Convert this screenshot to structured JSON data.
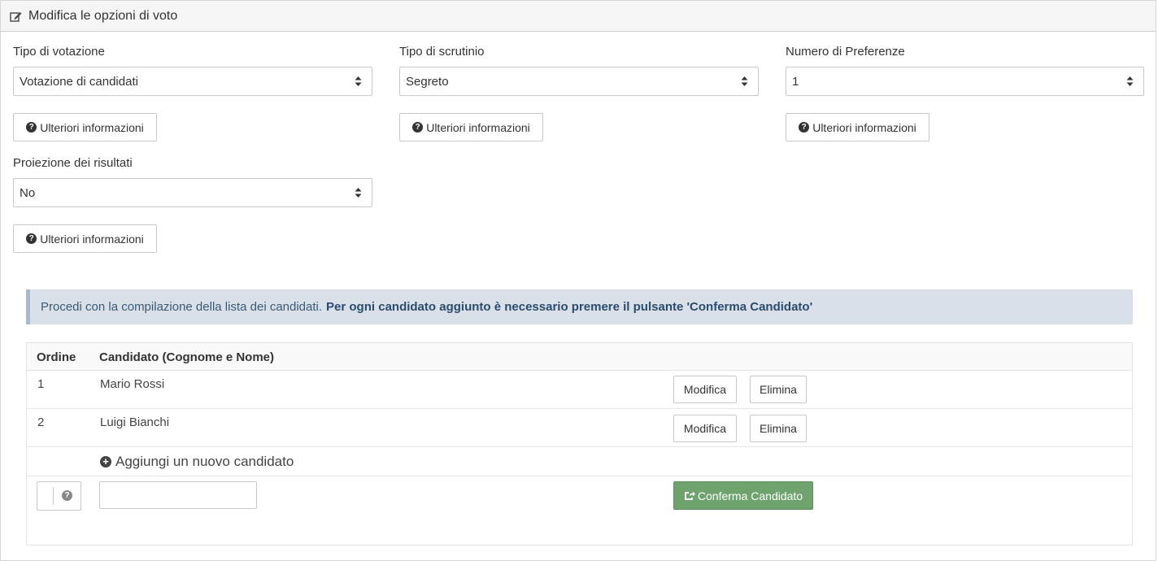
{
  "panel": {
    "title": "Modifica le opzioni di voto",
    "title_icon": "edit-icon"
  },
  "fields": {
    "tipo_votazione": {
      "label": "Tipo di votazione",
      "value": "Votazione di candidati"
    },
    "tipo_scrutinio": {
      "label": "Tipo di scrutinio",
      "value": "Segreto"
    },
    "numero_preferenze": {
      "label": "Numero di Preferenze",
      "value": "1"
    },
    "proiezione_risultati": {
      "label": "Proiezione dei risultati",
      "value": "No"
    }
  },
  "info_button_label": "Ulteriori informazioni",
  "alert": {
    "text": "Procedi con la compilazione della lista dei candidati.",
    "bold_text": "Per ogni candidato aggiunto è necessario premere il pulsante 'Conferma Candidato'"
  },
  "table": {
    "headers": {
      "order": "Ordine",
      "candidate": "Candidato (Cognome e Nome)"
    },
    "rows": [
      {
        "order": "1",
        "name": "Mario Rossi"
      },
      {
        "order": "2",
        "name": "Luigi Bianchi"
      }
    ],
    "edit_label": "Modifica",
    "delete_label": "Elimina",
    "add_label": "Aggiungi un nuovo candidato",
    "confirm_label": "Conferma Candidato"
  },
  "colors": {
    "alert_bg": "#d9e0e8",
    "confirm_green": "#6ea36e"
  }
}
